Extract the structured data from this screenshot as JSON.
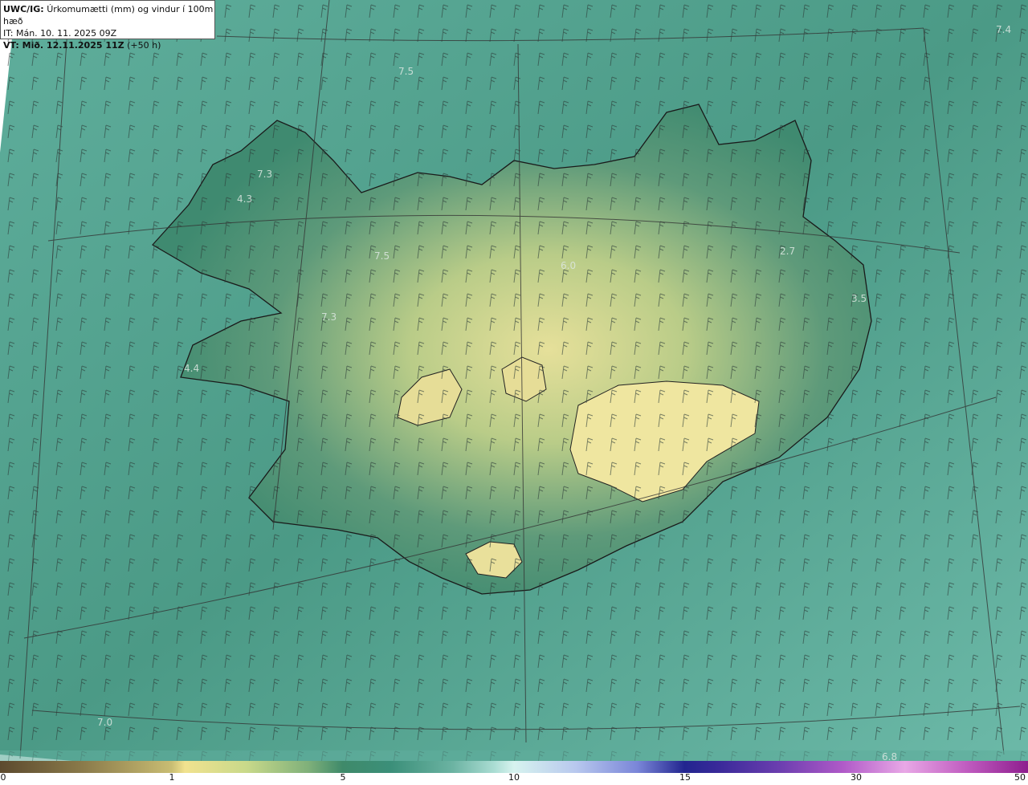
{
  "header": {
    "product": "UWC/IG:",
    "description": "Úrkomumætti (mm) og vindur í 100m hæð",
    "issue_time": "IT: Mán. 10. 11. 2025 09Z",
    "valid_label": "VT: Mið. 12.11.2025 11Z",
    "valid_offset": "(+50 h)"
  },
  "map_labels": [
    "7.5",
    "7.3",
    "4.3",
    "7.5",
    "7.3",
    "4.4",
    "6.0",
    "2.7",
    "3.5",
    "7.4",
    "7.0",
    "6.8"
  ],
  "colorbar": {
    "ticks": [
      "0",
      "1",
      "5",
      "10",
      "15",
      "30",
      "50"
    ]
  }
}
